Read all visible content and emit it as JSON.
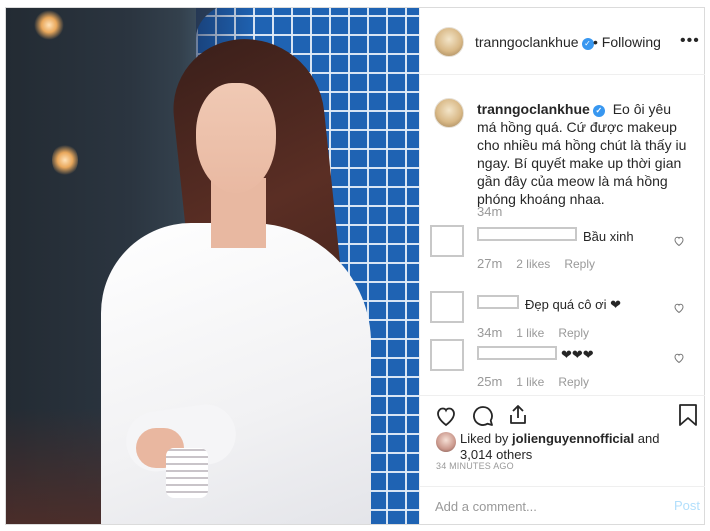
{
  "post": {
    "author": "tranngoclankhue",
    "follow_status": "• Following",
    "more_label": "•••",
    "caption": "Eo ôi yêu má hồng quá. Cứ được makeup cho nhiều má hồng chút là thấy iu ngay. Bí quyết make up thời gian gần đây của meow là má hồng phóng khoáng nhaa.",
    "caption_time": "34m",
    "verified_glyph": "✓"
  },
  "comments": [
    {
      "text": "Bầu xinh",
      "time": "27m",
      "likes": "2 likes",
      "reply": "Reply"
    },
    {
      "text": "Đẹp quá cô ơi ❤",
      "time": "34m",
      "likes": "1 like",
      "reply": "Reply"
    },
    {
      "text": "❤❤❤",
      "time": "25m",
      "likes": "1 like",
      "reply": "Reply"
    }
  ],
  "likes": {
    "liked_by_prefix": "Liked by ",
    "liked_by_user": "jolienguyennofficial",
    "and": " and",
    "others": "3,014 others"
  },
  "posted_time": "34 MINUTES AGO",
  "comment_box": {
    "placeholder": "Add a comment...",
    "post_label": "Post"
  },
  "colors": {
    "verified": "#3897f0",
    "post_button": "#b2dffc",
    "muted_text": "#999999"
  },
  "icons": {
    "like": "heart-icon",
    "comment": "comment-icon",
    "share": "share-icon",
    "save": "bookmark-icon",
    "more": "more-options-icon"
  }
}
